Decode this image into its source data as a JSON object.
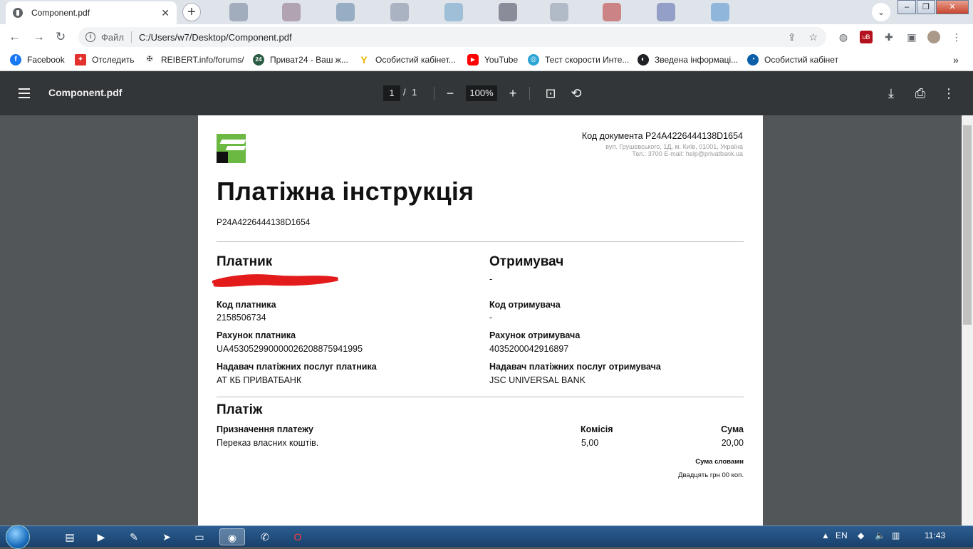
{
  "browser": {
    "tab_title": "Component.pdf",
    "new_tab_label": "+",
    "url_scheme": "Файл",
    "url": "C:/Users/w7/Desktop/Component.pdf",
    "window_controls": {
      "minimize": "–",
      "restore": "❐",
      "close": "✕"
    }
  },
  "bookmarks": [
    {
      "label": "Facebook",
      "icon": "facebook-icon",
      "color": "#1877f2"
    },
    {
      "label": "Отследить",
      "icon": "nova-poshta-icon",
      "color": "#e3312d"
    },
    {
      "label": "REIBERT.info/forums/",
      "icon": "cross-icon",
      "color": "#222222"
    },
    {
      "label": "Приват24 - Ваш ж...",
      "icon": "privat24-icon",
      "color": "#2a5c44"
    },
    {
      "label": "Особистий кабінет...",
      "icon": "y-icon",
      "color": "#f0b400"
    },
    {
      "label": "YouTube",
      "icon": "youtube-icon",
      "color": "#ff0000"
    },
    {
      "label": "Тест скорости Инте...",
      "icon": "speedtest-icon",
      "color": "#2aa4d5"
    },
    {
      "label": "Зведена інформаці...",
      "icon": "globe-icon",
      "color": "#202124"
    },
    {
      "label": "Особистий кабінет",
      "icon": "kyivstar-icon",
      "color": "#0a5fa8"
    }
  ],
  "pdf_toolbar": {
    "title": "Component.pdf",
    "page_current": "1",
    "page_sep": "/",
    "page_total": "1",
    "zoom": "100%"
  },
  "document": {
    "code_line": "Код документа P24A4226444138D1654",
    "address_line": "вул. Грушевського, 1Д, м. Київ, 01001, Україна",
    "contact_line": "Тел.: 3700  E-mail: help@privatbank.ua",
    "title": "Платіжна інструкція",
    "doc_id": "P24A4226444138D1654",
    "payer": {
      "heading": "Платник",
      "code_label": "Код платника",
      "code_value": "2158506734",
      "account_label": "Рахунок платника",
      "account_value": "UA453052990000026208875941995",
      "provider_label": "Надавач платіжних послуг платника",
      "provider_value": "АТ КБ ПРИВАТБАНК"
    },
    "recipient": {
      "heading": "Отримувач",
      "name_value": "-",
      "code_label": "Код отримувача",
      "code_value": "-",
      "account_label": "Рахунок отримувача",
      "account_value": "4035200042916897",
      "provider_label": "Надавач платіжних послуг отримувача",
      "provider_value": "JSC UNIVERSAL BANK"
    },
    "payment": {
      "heading": "Платіж",
      "purpose_label": "Призначення платежу",
      "purpose_value": "Переказ власних коштів.",
      "commission_label": "Комісія",
      "commission_value": "5,00",
      "amount_label": "Сума",
      "amount_value": "20,00",
      "words_label": "Сума словами",
      "words_value": "Двадцять грн 00 коп."
    }
  },
  "taskbar": {
    "lang": "EN",
    "clock": "11:43"
  }
}
